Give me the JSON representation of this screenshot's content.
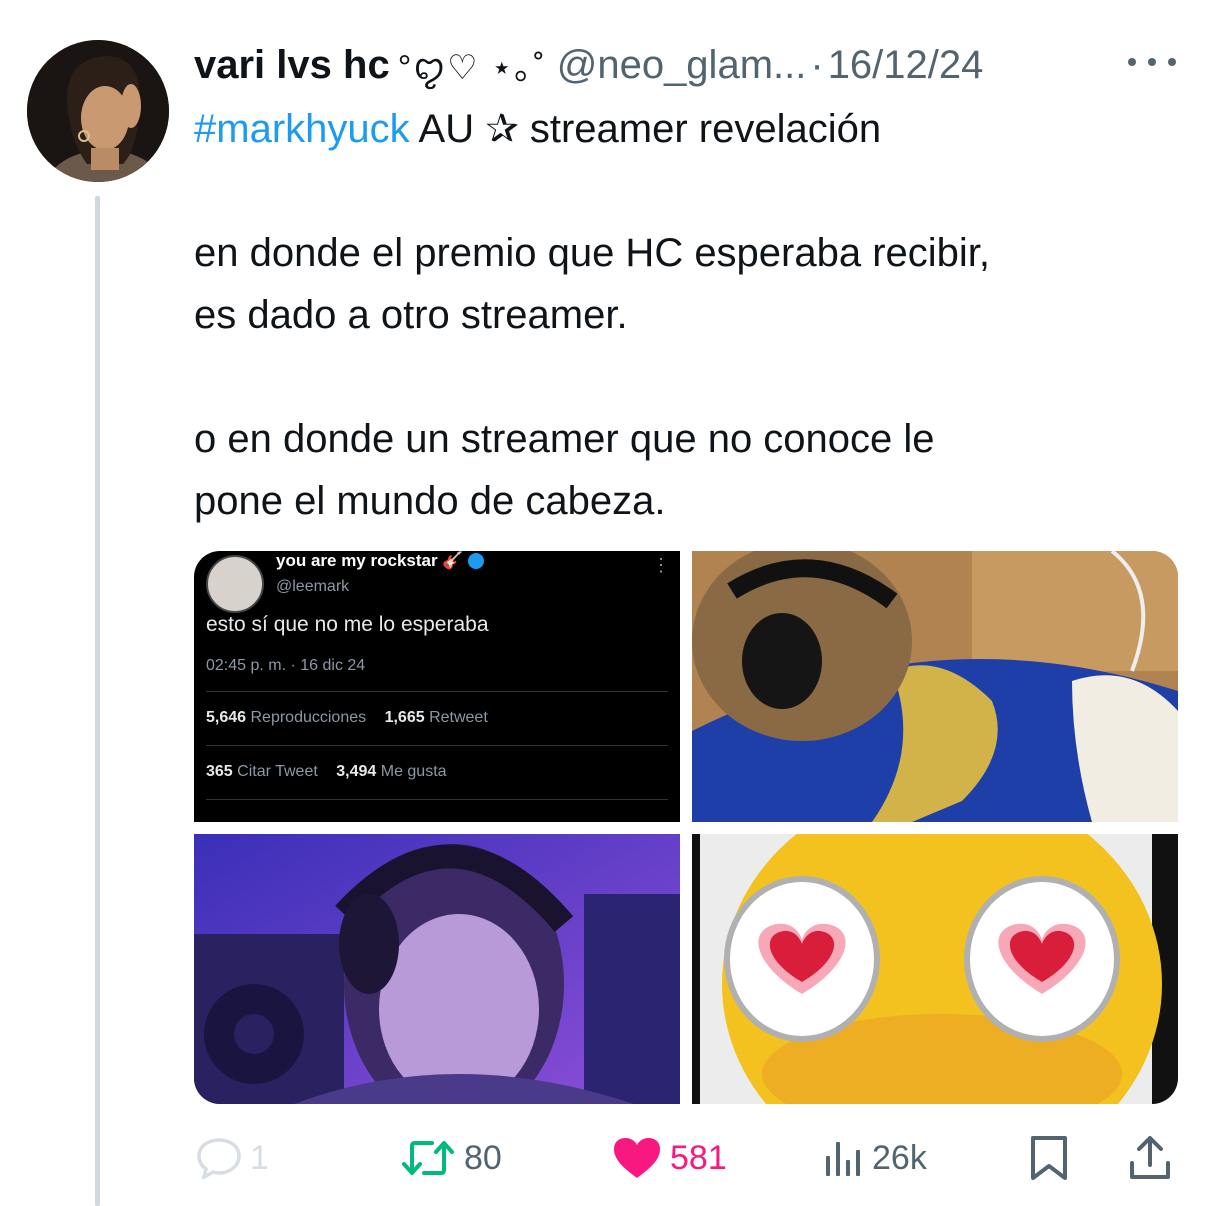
{
  "tweet": {
    "display_name": "vari lvs hc",
    "name_decoration": "°ꨄ︎♡ ⋆｡˚",
    "handle": "@neo_glam...",
    "separator": "·",
    "date": "16/12/24",
    "body": {
      "hashtag": "#markhyuck",
      "line1_rest": " AU ✰ streamer revelación",
      "para2": [
        "en donde el premio que HC esperaba recibir,",
        "es dado a otro streamer."
      ],
      "para3": [
        "o en donde un streamer que no conoce le",
        "pone el mundo de cabeza."
      ]
    }
  },
  "media": {
    "embedded_tweet": {
      "name": "you are my rockstar",
      "name_emoji": "🎸",
      "handle": "@leemark",
      "text": "esto sí que no me lo esperaba",
      "time": "02:45 p. m. · 16 dic 24",
      "views_count": "5,646",
      "views_label": "Reproducciones",
      "retweets_count": "1,665",
      "retweets_label": "Retweet",
      "quotes_count": "365",
      "quotes_label": "Citar Tweet",
      "likes_count": "3,494",
      "likes_label": "Me gusta"
    },
    "photos": [
      "headphones-back-photo",
      "headphones-purple-photo",
      "heart-eyes-emoji-image"
    ]
  },
  "actions": {
    "replies": "1",
    "retweets": "80",
    "likes": "581",
    "views": "26k"
  },
  "colors": {
    "link": "#1d9bf0",
    "retweet": "#00ba7c",
    "like": "#f91880",
    "muted": "#536471"
  }
}
